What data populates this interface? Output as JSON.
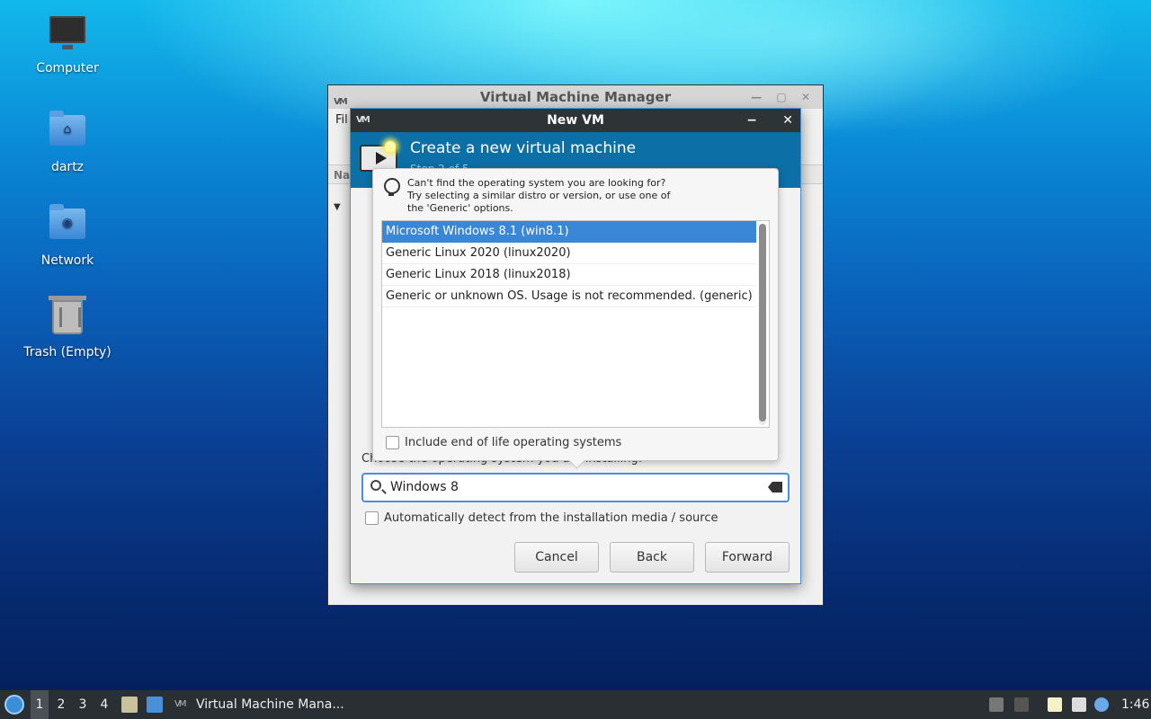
{
  "desktop": {
    "icons": [
      {
        "label": "Computer"
      },
      {
        "label": "dartz"
      },
      {
        "label": "Network"
      },
      {
        "label": "Trash (Empty)"
      }
    ]
  },
  "vmm": {
    "title": "Virtual Machine Manager",
    "wm_logo": "VM",
    "menu_first": "Fil",
    "col_header": "Na"
  },
  "newvm": {
    "title": "New VM",
    "wm_logo": "VM",
    "minimize": "−",
    "close": "✕",
    "header_title": "Create a new virtual machine",
    "header_step": "Step 2 of 5",
    "choose_label": "Choose the operating system you are installing:",
    "search": {
      "value": "Windows 8",
      "placeholder": ""
    },
    "autodetect_label": "Automatically detect from the installation media / source",
    "buttons": {
      "cancel": "Cancel",
      "back": "Back",
      "forward": "Forward"
    }
  },
  "popover": {
    "hint_lines": [
      "Can't find the operating system you are looking for?",
      "Try selecting a similar distro or version, or use one of",
      "the 'Generic' options."
    ],
    "os_options": [
      {
        "label": "Microsoft Windows 8.1 (win8.1)",
        "selected": true
      },
      {
        "label": "Generic Linux 2020 (linux2020)",
        "selected": false
      },
      {
        "label": "Generic Linux 2018 (linux2018)",
        "selected": false
      },
      {
        "label": "Generic or unknown OS. Usage is not recommended. (generic)",
        "selected": false
      }
    ],
    "eol_label": "Include end of life operating systems"
  },
  "taskbar": {
    "workspaces": [
      "1",
      "2",
      "3",
      "4"
    ],
    "active_workspace": "1",
    "task_label": "Virtual Machine Mana...",
    "task_logo": "VM",
    "clock": "1:46"
  },
  "colors": {
    "accent": "#3a87d8",
    "dialog_header": "#0c6fa5",
    "titlebar_dark": "#2e3436"
  }
}
